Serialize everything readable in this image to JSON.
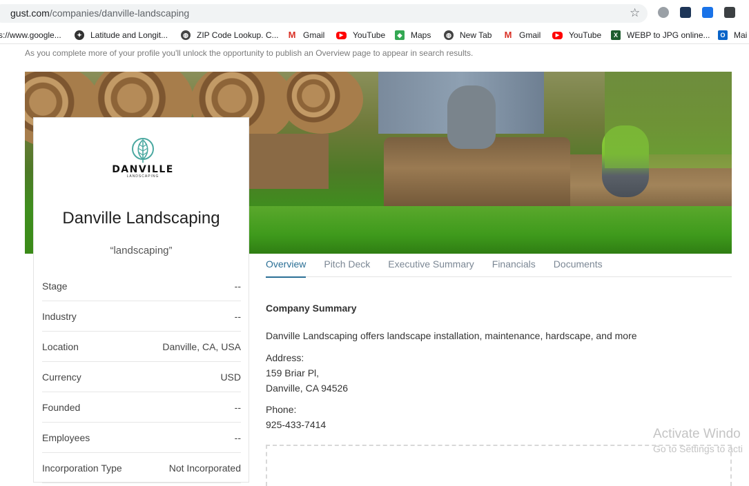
{
  "browser": {
    "url_domain": "gust.com",
    "url_path": "/companies/danville-landscaping",
    "bookmarks": [
      {
        "label": "s://www.google...",
        "icon": "none"
      },
      {
        "label": "Latitude and Longit...",
        "icon": "compass-icon"
      },
      {
        "label": "ZIP Code Lookup. C...",
        "icon": "globe-icon"
      },
      {
        "label": "Gmail",
        "icon": "gmail-icon"
      },
      {
        "label": "YouTube",
        "icon": "youtube-icon"
      },
      {
        "label": "Maps",
        "icon": "maps-icon"
      },
      {
        "label": "New Tab",
        "icon": "globe-icon"
      },
      {
        "label": "Gmail",
        "icon": "gmail-icon"
      },
      {
        "label": "YouTube",
        "icon": "youtube-icon"
      },
      {
        "label": "WEBP to JPG online...",
        "icon": "webp-icon"
      },
      {
        "label": "Mai",
        "icon": "outlook-icon"
      }
    ]
  },
  "notice": "As you complete more of your profile you'll unlock the opportunity to publish an Overview page to appear in search results.",
  "company": {
    "logo_text": "DANVILLE",
    "logo_subtext": "LANDSCAPING",
    "name": "Danville Landscaping",
    "tagline": "“landscaping”",
    "details": [
      {
        "label": "Stage",
        "value": "--"
      },
      {
        "label": "Industry",
        "value": "--"
      },
      {
        "label": "Location",
        "value": "Danville, CA, USA"
      },
      {
        "label": "Currency",
        "value": "USD"
      },
      {
        "label": "Founded",
        "value": "--"
      },
      {
        "label": "Employees",
        "value": "--"
      },
      {
        "label": "Incorporation Type",
        "value": "Not Incorporated"
      }
    ]
  },
  "tabs": [
    "Overview",
    "Pitch Deck",
    "Executive Summary",
    "Financials",
    "Documents"
  ],
  "summary": {
    "title": "Company Summary",
    "description": "Danville Landscaping offers landscape installation, maintenance, hardscape, and more",
    "address_label": "Address:",
    "address_line1": "159 Briar Pl,",
    "address_line2": "Danville, CA 94526",
    "phone_label": "Phone:",
    "phone": "925-433-7414"
  },
  "watermark": {
    "line1": "Activate Windo",
    "line2": "Go to Settings to acti"
  },
  "colors": {
    "accent": "#2a6f95",
    "logo_leaf": "#4aa8a0"
  }
}
